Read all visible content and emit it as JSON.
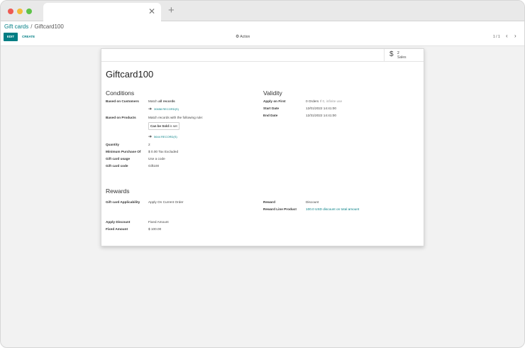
{
  "browser": {
    "tab_close": "✕",
    "new_tab": "+"
  },
  "breadcrumb": {
    "parent": "Gift cards",
    "separator": "/",
    "current": "Giftcard100"
  },
  "toolbar": {
    "edit_label": "EDIT",
    "create_label": "CREATE",
    "action_label": "Action",
    "pager": "1 / 1",
    "prev": "‹",
    "next": "›"
  },
  "stat": {
    "icon": "$",
    "value": "2",
    "label": "Sales"
  },
  "program": {
    "name": "Giftcard100"
  },
  "conditions": {
    "heading": "Conditions",
    "customers_label": "Based on Customers",
    "customers_prefix": "Match ",
    "customers_bold": "all records",
    "customers_records": "30658 RECORD(S)",
    "products_label": "Based on Products",
    "products_value": "Match records with the following rule:",
    "rule_field": "Can be Sold",
    "rule_op": "is set",
    "products_records": "5644 RECORD(S)",
    "quantity_label": "Quantity",
    "quantity_value": "2",
    "min_purchase_label": "Minimum Purchase Of",
    "min_purchase_value": "$ 0.00  Tax Excluded",
    "usage_label": "Gift card usage",
    "usage_value": "Use a code",
    "code_label": "Gift card code",
    "code_value": "Gift100"
  },
  "validity": {
    "heading": "Validity",
    "apply_first_label": "Apply on First",
    "apply_first_value": "0 Orders",
    "apply_first_hint": "If 0, infinite use",
    "start_label": "Start Date",
    "start_value": "12/01/2022 14:41:00",
    "end_label": "End Date",
    "end_value": "12/31/2022 14:41:00"
  },
  "rewards": {
    "heading": "Rewards",
    "applicability_label": "Gift card Applicability",
    "applicability_value": "Apply On Current Order",
    "reward_label": "Reward",
    "reward_value": "Discount",
    "line_product_label": "Reward Line Product",
    "line_product_value": "100.0 USD discount on total amount",
    "apply_discount_label": "Apply Discount",
    "apply_discount_value": "Fixed Amount",
    "fixed_amount_label": "Fixed Amount",
    "fixed_amount_value": "$ 100.00"
  },
  "colors": {
    "brand": "#017e84",
    "window_red": "#ee5a52",
    "window_yellow": "#f1bc3a",
    "window_green": "#5ec348"
  }
}
